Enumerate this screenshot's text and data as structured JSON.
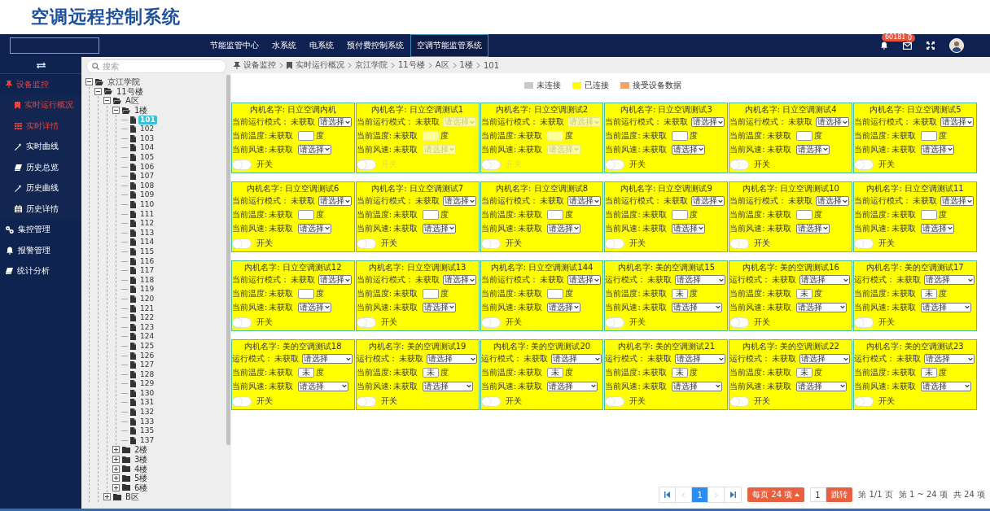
{
  "page_title": "空调远程控制系统",
  "top_bar": {
    "nav": [
      {
        "label": "节能监管中心",
        "selected": false
      },
      {
        "label": "水系统",
        "selected": false
      },
      {
        "label": "电系统",
        "selected": false
      },
      {
        "label": "预付费控制系统",
        "selected": false
      },
      {
        "label": "空调节能监管系统",
        "selected": true
      }
    ],
    "notifications_badge": "60181",
    "messages_badge": "0"
  },
  "sidebar": {
    "items": [
      {
        "label": "设备监控",
        "expanded": true,
        "children": [
          {
            "label": "实时运行概况",
            "selected": true
          },
          {
            "label": "实时详情",
            "selected": true
          },
          {
            "label": "实时曲线",
            "selected": false
          },
          {
            "label": "历史总览",
            "selected": false
          },
          {
            "label": "历史曲线",
            "selected": false
          },
          {
            "label": "历史详情",
            "selected": false
          }
        ]
      },
      {
        "label": "集控管理",
        "expanded": false
      },
      {
        "label": "报警管理",
        "expanded": false
      },
      {
        "label": "统计分析",
        "expanded": false
      }
    ]
  },
  "tree": {
    "search_placeholder": "搜索",
    "nodes": [
      {
        "label": "京江学院",
        "expanded": true,
        "children": [
          {
            "label": "11号楼",
            "expanded": true,
            "children": [
              {
                "label": "A区",
                "expanded": true,
                "children": [
                  {
                    "label": "1楼",
                    "expanded": true,
                    "children": [
                      {
                        "label": "101",
                        "selected": true
                      },
                      {
                        "label": "102",
                        "selected": false
                      },
                      {
                        "label": "103",
                        "selected": false
                      },
                      {
                        "label": "104",
                        "selected": false
                      },
                      {
                        "label": "105",
                        "selected": false
                      },
                      {
                        "label": "106",
                        "selected": false
                      },
                      {
                        "label": "107",
                        "selected": false
                      },
                      {
                        "label": "108",
                        "selected": false
                      },
                      {
                        "label": "109",
                        "selected": false
                      },
                      {
                        "label": "110",
                        "selected": false
                      },
                      {
                        "label": "111",
                        "selected": false
                      },
                      {
                        "label": "112",
                        "selected": false
                      },
                      {
                        "label": "113",
                        "selected": false
                      },
                      {
                        "label": "114",
                        "selected": false
                      },
                      {
                        "label": "115",
                        "selected": false
                      },
                      {
                        "label": "116",
                        "selected": false
                      },
                      {
                        "label": "117",
                        "selected": false
                      },
                      {
                        "label": "118",
                        "selected": false
                      },
                      {
                        "label": "119",
                        "selected": false
                      },
                      {
                        "label": "120",
                        "selected": false
                      },
                      {
                        "label": "121",
                        "selected": false
                      },
                      {
                        "label": "122",
                        "selected": false
                      },
                      {
                        "label": "123",
                        "selected": false
                      },
                      {
                        "label": "124",
                        "selected": false
                      },
                      {
                        "label": "125",
                        "selected": false
                      },
                      {
                        "label": "126",
                        "selected": false
                      },
                      {
                        "label": "127",
                        "selected": false
                      },
                      {
                        "label": "128",
                        "selected": false
                      },
                      {
                        "label": "129",
                        "selected": false
                      },
                      {
                        "label": "130",
                        "selected": false
                      },
                      {
                        "label": "131",
                        "selected": false
                      },
                      {
                        "label": "132",
                        "selected": false
                      },
                      {
                        "label": "133",
                        "selected": false
                      },
                      {
                        "label": "135",
                        "selected": false
                      },
                      {
                        "label": "137",
                        "selected": false
                      }
                    ]
                  },
                  {
                    "label": "2楼",
                    "expanded": false
                  },
                  {
                    "label": "3楼",
                    "expanded": false
                  },
                  {
                    "label": "4楼",
                    "expanded": false
                  },
                  {
                    "label": "5楼",
                    "expanded": false
                  },
                  {
                    "label": "6楼",
                    "expanded": false
                  }
                ]
              },
              {
                "label": "B区",
                "expanded": false
              }
            ]
          }
        ]
      }
    ]
  },
  "breadcrumb": [
    {
      "label": "设备监控"
    },
    {
      "label": "实时运行概况"
    },
    {
      "label": "京江学院"
    },
    {
      "label": "11号楼"
    },
    {
      "label": "A区"
    },
    {
      "label": "1楼"
    },
    {
      "label": "101"
    }
  ],
  "legend": [
    {
      "label": "未连接",
      "color": "#c8c8c8"
    },
    {
      "label": "已连接",
      "color": "#ffff00"
    },
    {
      "label": "接受设备数据",
      "color": "#f4a26b"
    }
  ],
  "cards": [
    {
      "title": "内机名字: 日立空调内机",
      "kind": "hitachi",
      "disabled": false,
      "mode_label": "当前运行模式：",
      "mode_value": "未获取",
      "mode_select": "请选择",
      "temp_label": "当前温度:",
      "temp_value": "未获取",
      "temp_unit": "度",
      "fan_label": "当前风速:",
      "fan_value": "未获取",
      "fan_select": "请选择",
      "switch_label": "开关",
      "switch_on": false
    },
    {
      "title": "内机名字: 日立空调测试1",
      "kind": "hitachi",
      "disabled": true,
      "mode_label": "当前运行模式：",
      "mode_value": "未获取",
      "mode_select": "请选择",
      "temp_label": "当前温度:",
      "temp_value": "未获取",
      "temp_unit": "度",
      "fan_label": "当前风速:",
      "fan_value": "未获取",
      "fan_select": "请选择",
      "switch_label": "开关",
      "switch_on": false
    },
    {
      "title": "内机名字: 日立空调测试2",
      "kind": "hitachi",
      "disabled": true,
      "mode_label": "当前运行模式：",
      "mode_value": "未获取",
      "mode_select": "请选择",
      "temp_label": "当前温度:",
      "temp_value": "未获取",
      "temp_unit": "度",
      "fan_label": "当前风速:",
      "fan_value": "未获取",
      "fan_select": "请选择",
      "switch_label": "开关",
      "switch_on": false
    },
    {
      "title": "内机名字: 日立空调测试3",
      "kind": "hitachi",
      "disabled": false,
      "mode_label": "当前运行模式：",
      "mode_value": "未获取",
      "mode_select": "请选择",
      "temp_label": "当前温度:",
      "temp_value": "未获取",
      "temp_unit": "度",
      "fan_label": "当前风速:",
      "fan_value": "未获取",
      "fan_select": "请选择",
      "switch_label": "开关",
      "switch_on": false
    },
    {
      "title": "内机名字: 日立空调测试4",
      "kind": "hitachi",
      "disabled": false,
      "mode_label": "当前运行模式：",
      "mode_value": "未获取",
      "mode_select": "请选择",
      "temp_label": "当前温度:",
      "temp_value": "未获取",
      "temp_unit": "度",
      "fan_label": "当前风速:",
      "fan_value": "未获取",
      "fan_select": "请选择",
      "switch_label": "开关",
      "switch_on": false
    },
    {
      "title": "内机名字: 日立空调测试5",
      "kind": "hitachi",
      "disabled": false,
      "mode_label": "当前运行模式：",
      "mode_value": "未获取",
      "mode_select": "请选择",
      "temp_label": "当前温度:",
      "temp_value": "未获取",
      "temp_unit": "度",
      "fan_label": "当前风速:",
      "fan_value": "未获取",
      "fan_select": "请选择",
      "switch_label": "开关",
      "switch_on": false
    },
    {
      "title": "内机名字: 日立空调测试6",
      "kind": "hitachi",
      "disabled": false,
      "mode_label": "当前运行模式：",
      "mode_value": "未获取",
      "mode_select": "请选择",
      "temp_label": "当前温度:",
      "temp_value": "未获取",
      "temp_unit": "度",
      "fan_label": "当前风速:",
      "fan_value": "未获取",
      "fan_select": "请选择",
      "switch_label": "开关",
      "switch_on": false
    },
    {
      "title": "内机名字: 日立空调测试7",
      "kind": "hitachi",
      "disabled": false,
      "mode_label": "当前运行模式：",
      "mode_value": "未获取",
      "mode_select": "请选择",
      "temp_label": "当前温度:",
      "temp_value": "未获取",
      "temp_unit": "度",
      "fan_label": "当前风速:",
      "fan_value": "未获取",
      "fan_select": "请选择",
      "switch_label": "开关",
      "switch_on": false
    },
    {
      "title": "内机名字: 日立空调测试8",
      "kind": "hitachi",
      "disabled": false,
      "mode_label": "当前运行模式：",
      "mode_value": "未获取",
      "mode_select": "请选择",
      "temp_label": "当前温度:",
      "temp_value": "未获取",
      "temp_unit": "度",
      "fan_label": "当前风速:",
      "fan_value": "未获取",
      "fan_select": "请选择",
      "switch_label": "开关",
      "switch_on": false
    },
    {
      "title": "内机名字: 日立空调测试9",
      "kind": "hitachi",
      "disabled": false,
      "mode_label": "当前运行模式：",
      "mode_value": "未获取",
      "mode_select": "请选择",
      "temp_label": "当前温度:",
      "temp_value": "未获取",
      "temp_unit": "度",
      "fan_label": "当前风速:",
      "fan_value": "未获取",
      "fan_select": "请选择",
      "switch_label": "开关",
      "switch_on": false
    },
    {
      "title": "内机名字: 日立空调测试10",
      "kind": "hitachi",
      "disabled": false,
      "mode_label": "当前运行模式：",
      "mode_value": "未获取",
      "mode_select": "请选择",
      "temp_label": "当前温度:",
      "temp_value": "未获取",
      "temp_unit": "度",
      "fan_label": "当前风速:",
      "fan_value": "未获取",
      "fan_select": "请选择",
      "switch_label": "开关",
      "switch_on": false
    },
    {
      "title": "内机名字: 日立空调测试11",
      "kind": "hitachi",
      "disabled": false,
      "mode_label": "当前运行模式：",
      "mode_value": "未获取",
      "mode_select": "请选择",
      "temp_label": "当前温度:",
      "temp_value": "未获取",
      "temp_unit": "度",
      "fan_label": "当前风速:",
      "fan_value": "未获取",
      "fan_select": "请选择",
      "switch_label": "开关",
      "switch_on": false
    },
    {
      "title": "内机名字: 日立空调测试12",
      "kind": "hitachi",
      "disabled": false,
      "mode_label": "当前运行模式：",
      "mode_value": "未获取",
      "mode_select": "请选择",
      "temp_label": "当前温度:",
      "temp_value": "未获取",
      "temp_unit": "度",
      "fan_label": "当前风速:",
      "fan_value": "未获取",
      "fan_select": "请选择",
      "switch_label": "开关",
      "switch_on": false
    },
    {
      "title": "内机名字: 日立空调测试13",
      "kind": "hitachi",
      "disabled": false,
      "mode_label": "当前运行模式：",
      "mode_value": "未获取",
      "mode_select": "请选择",
      "temp_label": "当前温度:",
      "temp_value": "未获取",
      "temp_unit": "度",
      "fan_label": "当前风速:",
      "fan_value": "未获取",
      "fan_select": "请选择",
      "switch_label": "开关",
      "switch_on": false
    },
    {
      "title": "内机名字: 日立空调测试144",
      "kind": "hitachi",
      "disabled": false,
      "mode_label": "当前运行模式：",
      "mode_value": "未获取",
      "mode_select": "请选择",
      "temp_label": "当前温度:",
      "temp_value": "未获取",
      "temp_unit": "度",
      "fan_label": "当前风速:",
      "fan_value": "未获取",
      "fan_select": "请选择",
      "switch_label": "开关",
      "switch_on": false
    },
    {
      "title": "内机名字: 美的空调测试15",
      "kind": "midea",
      "disabled": false,
      "mode_label": "运行模式：",
      "mode_value": "未获取",
      "mode_select": "请选择",
      "temp_label": "当前温度:",
      "temp_value": "未获取",
      "temp_input": "未",
      "temp_unit": "度",
      "fan_label": "当前风速:",
      "fan_value": "未获取",
      "fan_select": "请选择",
      "switch_label": "开关",
      "switch_on": false
    },
    {
      "title": "内机名字: 美的空调测试16",
      "kind": "midea",
      "disabled": false,
      "mode_label": "运行模式：",
      "mode_value": "未获取",
      "mode_select": "请选择",
      "temp_label": "当前温度:",
      "temp_value": "未获取",
      "temp_input": "未",
      "temp_unit": "度",
      "fan_label": "当前风速:",
      "fan_value": "未获取",
      "fan_select": "请选择",
      "switch_label": "开关",
      "switch_on": false
    },
    {
      "title": "内机名字: 美的空调测试17",
      "kind": "midea",
      "disabled": false,
      "mode_label": "运行模式：",
      "mode_value": "未获取",
      "mode_select": "请选择",
      "temp_label": "当前温度:",
      "temp_value": "未获取",
      "temp_input": "未",
      "temp_unit": "度",
      "fan_label": "当前风速:",
      "fan_value": "未获取",
      "fan_select": "请选择",
      "switch_label": "开关",
      "switch_on": false
    },
    {
      "title": "内机名字: 美的空调测试18",
      "kind": "midea",
      "disabled": false,
      "mode_label": "运行模式：",
      "mode_value": "未获取",
      "mode_select": "请选择",
      "temp_label": "当前温度:",
      "temp_value": "未获取",
      "temp_input": "未",
      "temp_unit": "度",
      "fan_label": "当前风速:",
      "fan_value": "未获取",
      "fan_select": "请选择",
      "switch_label": "开关",
      "switch_on": false
    },
    {
      "title": "内机名字: 美的空调测试19",
      "kind": "midea",
      "disabled": false,
      "mode_label": "运行模式：",
      "mode_value": "未获取",
      "mode_select": "请选择",
      "temp_label": "当前温度:",
      "temp_value": "未获取",
      "temp_input": "未",
      "temp_unit": "度",
      "fan_label": "当前风速:",
      "fan_value": "未获取",
      "fan_select": "请选择",
      "switch_label": "开关",
      "switch_on": false
    },
    {
      "title": "内机名字: 美的空调测试20",
      "kind": "midea",
      "disabled": false,
      "mode_label": "运行模式：",
      "mode_value": "未获取",
      "mode_select": "请选择",
      "temp_label": "当前温度:",
      "temp_value": "未获取",
      "temp_input": "未",
      "temp_unit": "度",
      "fan_label": "当前风速:",
      "fan_value": "未获取",
      "fan_select": "请选择",
      "switch_label": "开关",
      "switch_on": false
    },
    {
      "title": "内机名字: 美的空调测试21",
      "kind": "midea",
      "disabled": false,
      "mode_label": "运行模式：",
      "mode_value": "未获取",
      "mode_select": "请选择",
      "temp_label": "当前温度:",
      "temp_value": "未获取",
      "temp_input": "未",
      "temp_unit": "度",
      "fan_label": "当前风速:",
      "fan_value": "未获取",
      "fan_select": "请选择",
      "switch_label": "开关",
      "switch_on": false
    },
    {
      "title": "内机名字: 美的空调测试22",
      "kind": "midea",
      "disabled": false,
      "mode_label": "运行模式：",
      "mode_value": "未获取",
      "mode_select": "请选择",
      "temp_label": "当前温度:",
      "temp_value": "未获取",
      "temp_input": "未",
      "temp_unit": "度",
      "fan_label": "当前风速:",
      "fan_value": "未获取",
      "fan_select": "请选择",
      "switch_label": "开关",
      "switch_on": false
    },
    {
      "title": "内机名字: 美的空调测试23",
      "kind": "midea",
      "disabled": false,
      "mode_label": "运行模式：",
      "mode_value": "未获取",
      "mode_select": "请选择",
      "temp_label": "当前温度:",
      "temp_value": "未获取",
      "temp_input": "未",
      "temp_unit": "度",
      "fan_label": "当前风速:",
      "fan_value": "未获取",
      "fan_select": "请选择",
      "switch_label": "开关",
      "switch_on": false
    }
  ],
  "pager": {
    "nav_buttons": [
      {
        "kind": "first",
        "disabled": false
      },
      {
        "kind": "prev",
        "disabled": true
      },
      {
        "kind": "next",
        "disabled": true
      },
      {
        "kind": "last",
        "disabled": false
      }
    ],
    "pages": [
      {
        "label": "1",
        "selected": true
      }
    ],
    "page_size": "每页 24 项",
    "jump_value": "1",
    "jump_button": "跳转",
    "summary": [
      "第 1/1 页",
      "第 1 ~ 24 项",
      "共 24 项"
    ]
  }
}
